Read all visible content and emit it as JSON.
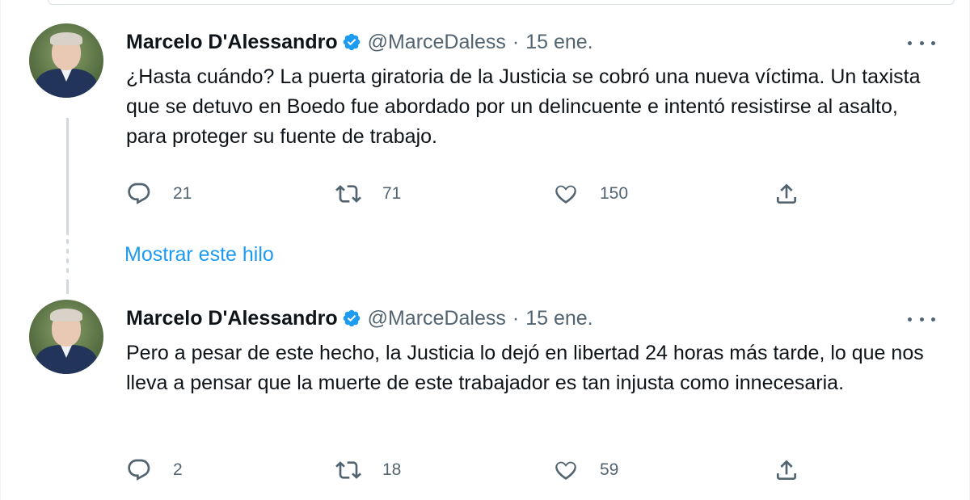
{
  "tweets": [
    {
      "name": "Marcelo D'Alessandro",
      "handle": "@MarceDaless",
      "separator": "·",
      "date": "15 ene.",
      "text": "¿Hasta cuándo? La puerta giratoria de la Justicia se cobró una nueva víctima. Un taxista que se detuvo en Boedo fue abordado por un delincuente e intentó resistirse al asalto, para proteger su fuente de trabajo.",
      "replies": "21",
      "retweets": "71",
      "likes": "150"
    },
    {
      "name": "Marcelo D'Alessandro",
      "handle": "@MarceDaless",
      "separator": "·",
      "date": "15 ene.",
      "text": "Pero a pesar de este hecho, la Justicia lo dejó en libertad 24 horas más tarde, lo que nos lleva a pensar que la muerte de este trabajador es tan injusta como innecesaria.",
      "replies": "2",
      "retweets": "18",
      "likes": "59"
    }
  ],
  "thread": {
    "show_thread_label": "Mostrar este hilo"
  },
  "colors": {
    "accent": "#1d9bf0",
    "secondary_text": "#536471",
    "primary_text": "#0f1419",
    "thread_line": "#cfd9de"
  },
  "icons": [
    "verified-badge-icon",
    "reply-icon",
    "retweet-icon",
    "like-icon",
    "share-icon",
    "more-icon"
  ]
}
